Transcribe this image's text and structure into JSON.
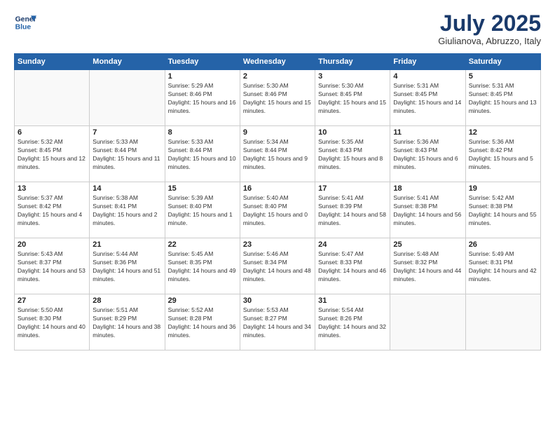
{
  "logo": {
    "line1": "General",
    "line2": "Blue"
  },
  "title": "July 2025",
  "subtitle": "Giulianova, Abruzzo, Italy",
  "weekdays": [
    "Sunday",
    "Monday",
    "Tuesday",
    "Wednesday",
    "Thursday",
    "Friday",
    "Saturday"
  ],
  "weeks": [
    [
      {
        "day": "",
        "sunrise": "",
        "sunset": "",
        "daylight": ""
      },
      {
        "day": "",
        "sunrise": "",
        "sunset": "",
        "daylight": ""
      },
      {
        "day": "1",
        "sunrise": "Sunrise: 5:29 AM",
        "sunset": "Sunset: 8:46 PM",
        "daylight": "Daylight: 15 hours and 16 minutes."
      },
      {
        "day": "2",
        "sunrise": "Sunrise: 5:30 AM",
        "sunset": "Sunset: 8:46 PM",
        "daylight": "Daylight: 15 hours and 15 minutes."
      },
      {
        "day": "3",
        "sunrise": "Sunrise: 5:30 AM",
        "sunset": "Sunset: 8:45 PM",
        "daylight": "Daylight: 15 hours and 15 minutes."
      },
      {
        "day": "4",
        "sunrise": "Sunrise: 5:31 AM",
        "sunset": "Sunset: 8:45 PM",
        "daylight": "Daylight: 15 hours and 14 minutes."
      },
      {
        "day": "5",
        "sunrise": "Sunrise: 5:31 AM",
        "sunset": "Sunset: 8:45 PM",
        "daylight": "Daylight: 15 hours and 13 minutes."
      }
    ],
    [
      {
        "day": "6",
        "sunrise": "Sunrise: 5:32 AM",
        "sunset": "Sunset: 8:45 PM",
        "daylight": "Daylight: 15 hours and 12 minutes."
      },
      {
        "day": "7",
        "sunrise": "Sunrise: 5:33 AM",
        "sunset": "Sunset: 8:44 PM",
        "daylight": "Daylight: 15 hours and 11 minutes."
      },
      {
        "day": "8",
        "sunrise": "Sunrise: 5:33 AM",
        "sunset": "Sunset: 8:44 PM",
        "daylight": "Daylight: 15 hours and 10 minutes."
      },
      {
        "day": "9",
        "sunrise": "Sunrise: 5:34 AM",
        "sunset": "Sunset: 8:44 PM",
        "daylight": "Daylight: 15 hours and 9 minutes."
      },
      {
        "day": "10",
        "sunrise": "Sunrise: 5:35 AM",
        "sunset": "Sunset: 8:43 PM",
        "daylight": "Daylight: 15 hours and 8 minutes."
      },
      {
        "day": "11",
        "sunrise": "Sunrise: 5:36 AM",
        "sunset": "Sunset: 8:43 PM",
        "daylight": "Daylight: 15 hours and 6 minutes."
      },
      {
        "day": "12",
        "sunrise": "Sunrise: 5:36 AM",
        "sunset": "Sunset: 8:42 PM",
        "daylight": "Daylight: 15 hours and 5 minutes."
      }
    ],
    [
      {
        "day": "13",
        "sunrise": "Sunrise: 5:37 AM",
        "sunset": "Sunset: 8:42 PM",
        "daylight": "Daylight: 15 hours and 4 minutes."
      },
      {
        "day": "14",
        "sunrise": "Sunrise: 5:38 AM",
        "sunset": "Sunset: 8:41 PM",
        "daylight": "Daylight: 15 hours and 2 minutes."
      },
      {
        "day": "15",
        "sunrise": "Sunrise: 5:39 AM",
        "sunset": "Sunset: 8:40 PM",
        "daylight": "Daylight: 15 hours and 1 minute."
      },
      {
        "day": "16",
        "sunrise": "Sunrise: 5:40 AM",
        "sunset": "Sunset: 8:40 PM",
        "daylight": "Daylight: 15 hours and 0 minutes."
      },
      {
        "day": "17",
        "sunrise": "Sunrise: 5:41 AM",
        "sunset": "Sunset: 8:39 PM",
        "daylight": "Daylight: 14 hours and 58 minutes."
      },
      {
        "day": "18",
        "sunrise": "Sunrise: 5:41 AM",
        "sunset": "Sunset: 8:38 PM",
        "daylight": "Daylight: 14 hours and 56 minutes."
      },
      {
        "day": "19",
        "sunrise": "Sunrise: 5:42 AM",
        "sunset": "Sunset: 8:38 PM",
        "daylight": "Daylight: 14 hours and 55 minutes."
      }
    ],
    [
      {
        "day": "20",
        "sunrise": "Sunrise: 5:43 AM",
        "sunset": "Sunset: 8:37 PM",
        "daylight": "Daylight: 14 hours and 53 minutes."
      },
      {
        "day": "21",
        "sunrise": "Sunrise: 5:44 AM",
        "sunset": "Sunset: 8:36 PM",
        "daylight": "Daylight: 14 hours and 51 minutes."
      },
      {
        "day": "22",
        "sunrise": "Sunrise: 5:45 AM",
        "sunset": "Sunset: 8:35 PM",
        "daylight": "Daylight: 14 hours and 49 minutes."
      },
      {
        "day": "23",
        "sunrise": "Sunrise: 5:46 AM",
        "sunset": "Sunset: 8:34 PM",
        "daylight": "Daylight: 14 hours and 48 minutes."
      },
      {
        "day": "24",
        "sunrise": "Sunrise: 5:47 AM",
        "sunset": "Sunset: 8:33 PM",
        "daylight": "Daylight: 14 hours and 46 minutes."
      },
      {
        "day": "25",
        "sunrise": "Sunrise: 5:48 AM",
        "sunset": "Sunset: 8:32 PM",
        "daylight": "Daylight: 14 hours and 44 minutes."
      },
      {
        "day": "26",
        "sunrise": "Sunrise: 5:49 AM",
        "sunset": "Sunset: 8:31 PM",
        "daylight": "Daylight: 14 hours and 42 minutes."
      }
    ],
    [
      {
        "day": "27",
        "sunrise": "Sunrise: 5:50 AM",
        "sunset": "Sunset: 8:30 PM",
        "daylight": "Daylight: 14 hours and 40 minutes."
      },
      {
        "day": "28",
        "sunrise": "Sunrise: 5:51 AM",
        "sunset": "Sunset: 8:29 PM",
        "daylight": "Daylight: 14 hours and 38 minutes."
      },
      {
        "day": "29",
        "sunrise": "Sunrise: 5:52 AM",
        "sunset": "Sunset: 8:28 PM",
        "daylight": "Daylight: 14 hours and 36 minutes."
      },
      {
        "day": "30",
        "sunrise": "Sunrise: 5:53 AM",
        "sunset": "Sunset: 8:27 PM",
        "daylight": "Daylight: 14 hours and 34 minutes."
      },
      {
        "day": "31",
        "sunrise": "Sunrise: 5:54 AM",
        "sunset": "Sunset: 8:26 PM",
        "daylight": "Daylight: 14 hours and 32 minutes."
      },
      {
        "day": "",
        "sunrise": "",
        "sunset": "",
        "daylight": ""
      },
      {
        "day": "",
        "sunrise": "",
        "sunset": "",
        "daylight": ""
      }
    ]
  ]
}
